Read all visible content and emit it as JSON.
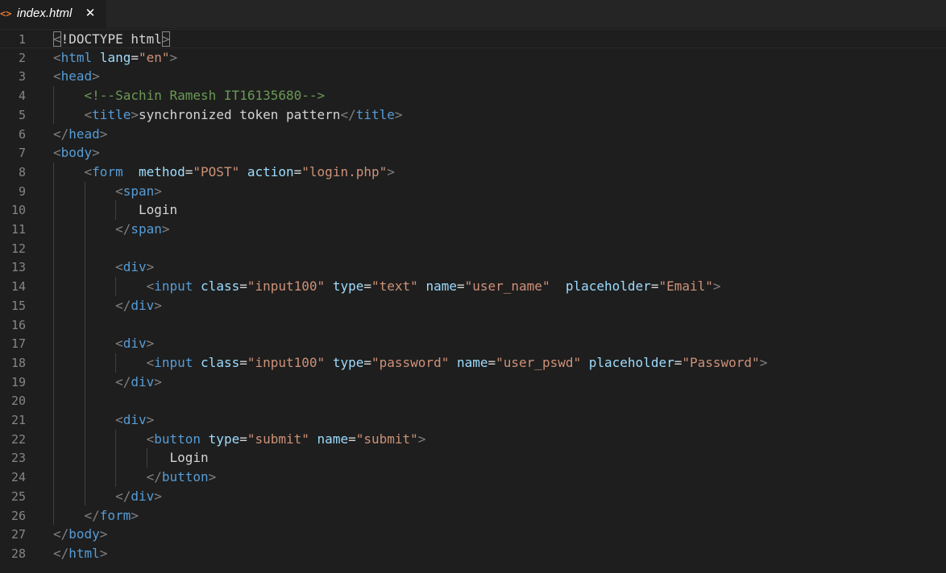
{
  "tab": {
    "icon": "html-file-icon",
    "icon_glyph": "<>",
    "filename": "index.html",
    "close_glyph": "✕"
  },
  "colors": {
    "background": "#1e1e1e",
    "tab_bar": "#252526",
    "line_number": "#858585",
    "tag_bracket": "#808080",
    "tag_name": "#569cd6",
    "attribute": "#9cdcfe",
    "string": "#ce9178",
    "comment": "#6a9955",
    "text": "#d4d4d4"
  },
  "lines": [
    {
      "n": "1",
      "indent": "",
      "tokens": [
        [
          "tg",
          "<"
        ],
        [
          "tx",
          "!DOCTYPE html"
        ],
        [
          "tg",
          ">"
        ]
      ]
    },
    {
      "n": "2",
      "indent": "",
      "tokens": [
        [
          "tg",
          "<"
        ],
        [
          "tn",
          "html"
        ],
        [
          "tx",
          " "
        ],
        [
          "at",
          "lang"
        ],
        [
          "tx",
          "="
        ],
        [
          "av",
          "\"en\""
        ],
        [
          "tg",
          ">"
        ]
      ]
    },
    {
      "n": "3",
      "indent": "",
      "tokens": [
        [
          "tg",
          "<"
        ],
        [
          "tn",
          "head"
        ],
        [
          "tg",
          ">"
        ]
      ]
    },
    {
      "n": "4",
      "indent": "    ",
      "tokens": [
        [
          "cm",
          "<!--Sachin Ramesh IT16135680-->"
        ]
      ]
    },
    {
      "n": "5",
      "indent": "    ",
      "tokens": [
        [
          "tg",
          "<"
        ],
        [
          "tn",
          "title"
        ],
        [
          "tg",
          ">"
        ],
        [
          "tx",
          "synchronized token pattern"
        ],
        [
          "tg",
          "</"
        ],
        [
          "tn",
          "title"
        ],
        [
          "tg",
          ">"
        ]
      ]
    },
    {
      "n": "6",
      "indent": "",
      "tokens": [
        [
          "tg",
          "</"
        ],
        [
          "tn",
          "head"
        ],
        [
          "tg",
          ">"
        ]
      ]
    },
    {
      "n": "7",
      "indent": "",
      "tokens": [
        [
          "tg",
          "<"
        ],
        [
          "tn",
          "body"
        ],
        [
          "tg",
          ">"
        ]
      ]
    },
    {
      "n": "8",
      "indent": "    ",
      "tokens": [
        [
          "tg",
          "<"
        ],
        [
          "tn",
          "form"
        ],
        [
          "tx",
          "  "
        ],
        [
          "at",
          "method"
        ],
        [
          "tx",
          "="
        ],
        [
          "av",
          "\"POST\""
        ],
        [
          "tx",
          " "
        ],
        [
          "at",
          "action"
        ],
        [
          "tx",
          "="
        ],
        [
          "av",
          "\"login.php\""
        ],
        [
          "tg",
          ">"
        ]
      ]
    },
    {
      "n": "9",
      "indent": "        ",
      "tokens": [
        [
          "tg",
          "<"
        ],
        [
          "tn",
          "span"
        ],
        [
          "tg",
          ">"
        ]
      ]
    },
    {
      "n": "10",
      "indent": "           ",
      "tokens": [
        [
          "tx",
          "Login"
        ]
      ]
    },
    {
      "n": "11",
      "indent": "        ",
      "tokens": [
        [
          "tg",
          "</"
        ],
        [
          "tn",
          "span"
        ],
        [
          "tg",
          ">"
        ]
      ]
    },
    {
      "n": "12",
      "indent": "",
      "tokens": []
    },
    {
      "n": "13",
      "indent": "        ",
      "tokens": [
        [
          "tg",
          "<"
        ],
        [
          "tn",
          "div"
        ],
        [
          "tg",
          ">"
        ]
      ]
    },
    {
      "n": "14",
      "indent": "            ",
      "tokens": [
        [
          "tg",
          "<"
        ],
        [
          "tn",
          "input"
        ],
        [
          "tx",
          " "
        ],
        [
          "at",
          "class"
        ],
        [
          "tx",
          "="
        ],
        [
          "av",
          "\"input100\""
        ],
        [
          "tx",
          " "
        ],
        [
          "at",
          "type"
        ],
        [
          "tx",
          "="
        ],
        [
          "av",
          "\"text\""
        ],
        [
          "tx",
          " "
        ],
        [
          "at",
          "name"
        ],
        [
          "tx",
          "="
        ],
        [
          "av",
          "\"user_name\""
        ],
        [
          "tx",
          "  "
        ],
        [
          "at",
          "placeholder"
        ],
        [
          "tx",
          "="
        ],
        [
          "av",
          "\"Email\""
        ],
        [
          "tg",
          ">"
        ]
      ]
    },
    {
      "n": "15",
      "indent": "        ",
      "tokens": [
        [
          "tg",
          "</"
        ],
        [
          "tn",
          "div"
        ],
        [
          "tg",
          ">"
        ]
      ]
    },
    {
      "n": "16",
      "indent": "",
      "tokens": []
    },
    {
      "n": "17",
      "indent": "        ",
      "tokens": [
        [
          "tg",
          "<"
        ],
        [
          "tn",
          "div"
        ],
        [
          "tg",
          ">"
        ]
      ]
    },
    {
      "n": "18",
      "indent": "            ",
      "tokens": [
        [
          "tg",
          "<"
        ],
        [
          "tn",
          "input"
        ],
        [
          "tx",
          " "
        ],
        [
          "at",
          "class"
        ],
        [
          "tx",
          "="
        ],
        [
          "av",
          "\"input100\""
        ],
        [
          "tx",
          " "
        ],
        [
          "at",
          "type"
        ],
        [
          "tx",
          "="
        ],
        [
          "av",
          "\"password\""
        ],
        [
          "tx",
          " "
        ],
        [
          "at",
          "name"
        ],
        [
          "tx",
          "="
        ],
        [
          "av",
          "\"user_pswd\""
        ],
        [
          "tx",
          " "
        ],
        [
          "at",
          "placeholder"
        ],
        [
          "tx",
          "="
        ],
        [
          "av",
          "\"Password\""
        ],
        [
          "tg",
          ">"
        ]
      ]
    },
    {
      "n": "19",
      "indent": "        ",
      "tokens": [
        [
          "tg",
          "</"
        ],
        [
          "tn",
          "div"
        ],
        [
          "tg",
          ">"
        ]
      ]
    },
    {
      "n": "20",
      "indent": "",
      "tokens": []
    },
    {
      "n": "21",
      "indent": "        ",
      "tokens": [
        [
          "tg",
          "<"
        ],
        [
          "tn",
          "div"
        ],
        [
          "tg",
          ">"
        ]
      ]
    },
    {
      "n": "22",
      "indent": "            ",
      "tokens": [
        [
          "tg",
          "<"
        ],
        [
          "tn",
          "button"
        ],
        [
          "tx",
          " "
        ],
        [
          "at",
          "type"
        ],
        [
          "tx",
          "="
        ],
        [
          "av",
          "\"submit\""
        ],
        [
          "tx",
          " "
        ],
        [
          "at",
          "name"
        ],
        [
          "tx",
          "="
        ],
        [
          "av",
          "\"submit\""
        ],
        [
          "tg",
          ">"
        ]
      ]
    },
    {
      "n": "23",
      "indent": "               ",
      "tokens": [
        [
          "tx",
          "Login"
        ]
      ]
    },
    {
      "n": "24",
      "indent": "            ",
      "tokens": [
        [
          "tg",
          "</"
        ],
        [
          "tn",
          "button"
        ],
        [
          "tg",
          ">"
        ]
      ]
    },
    {
      "n": "25",
      "indent": "        ",
      "tokens": [
        [
          "tg",
          "</"
        ],
        [
          "tn",
          "div"
        ],
        [
          "tg",
          ">"
        ]
      ]
    },
    {
      "n": "26",
      "indent": "    ",
      "tokens": [
        [
          "tg",
          "</"
        ],
        [
          "tn",
          "form"
        ],
        [
          "tg",
          ">"
        ]
      ]
    },
    {
      "n": "27",
      "indent": "",
      "tokens": [
        [
          "tg",
          "</"
        ],
        [
          "tn",
          "body"
        ],
        [
          "tg",
          ">"
        ]
      ]
    },
    {
      "n": "28",
      "indent": "",
      "tokens": [
        [
          "tg",
          "</"
        ],
        [
          "tn",
          "html"
        ],
        [
          "tg",
          ">"
        ]
      ]
    }
  ]
}
